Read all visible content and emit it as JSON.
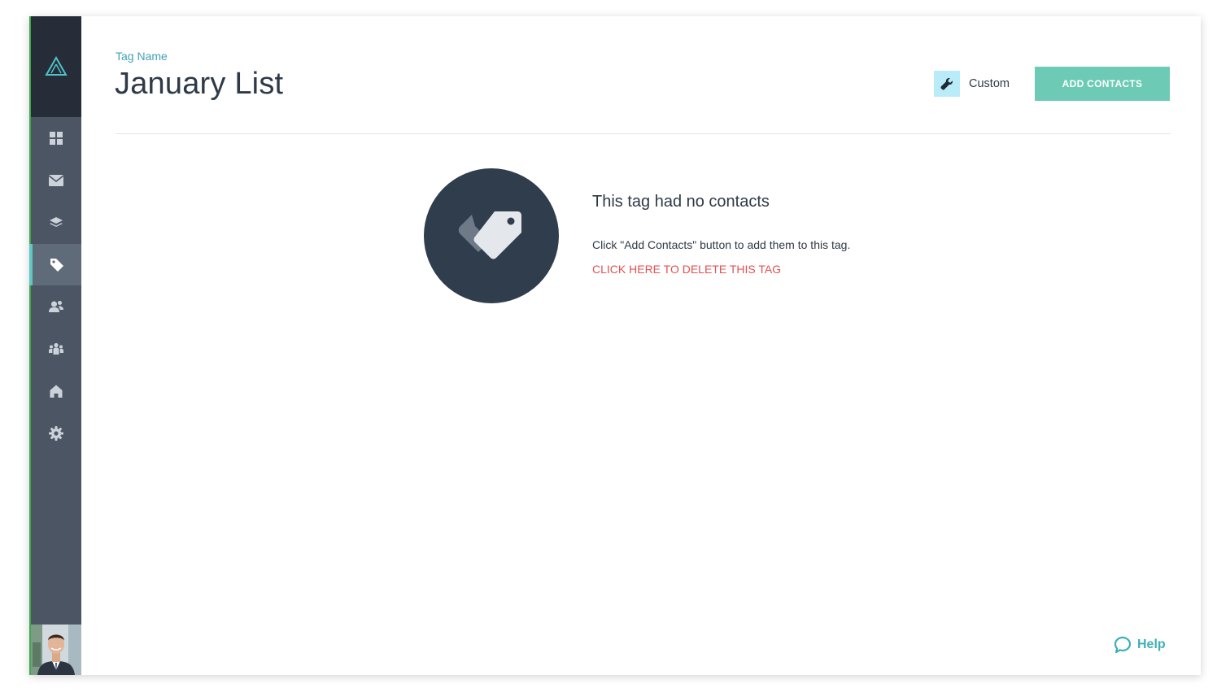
{
  "colors": {
    "sidebar_bg": "#4b5563",
    "sidebar_logo_bg": "#262d38",
    "sidebar_active_bg": "#5f6b79",
    "active_indicator": "#5fc7c4",
    "accent_teal": "#6ccab5",
    "eyebrow_blue": "#3fa1b8",
    "delete_red": "#e05253",
    "icon_circle": "#2f3d4d"
  },
  "sidebar": {
    "logo_icon": "triangle-logo-icon",
    "items": [
      {
        "name": "dashboard",
        "icon": "grid-icon",
        "active": false
      },
      {
        "name": "mail",
        "icon": "envelope-icon",
        "active": false
      },
      {
        "name": "layers",
        "icon": "layers-icon",
        "active": false
      },
      {
        "name": "tags",
        "icon": "tag-icon",
        "active": true
      },
      {
        "name": "contacts",
        "icon": "users-icon",
        "active": false
      },
      {
        "name": "groups",
        "icon": "group-icon",
        "active": false
      },
      {
        "name": "home",
        "icon": "home-icon",
        "active": false
      },
      {
        "name": "settings",
        "icon": "gear-icon",
        "active": false
      }
    ],
    "avatar": "user-avatar"
  },
  "header": {
    "eyebrow": "Tag Name",
    "title": "January List",
    "custom_label": "Custom",
    "add_button_label": "ADD CONTACTS"
  },
  "empty_state": {
    "icon": "tags-icon",
    "title": "This tag had no contacts",
    "description": "Click \"Add Contacts\" button to add them to this tag.",
    "delete_link": "CLICK HERE TO DELETE THIS TAG"
  },
  "help": {
    "label": "Help",
    "icon": "chat-bubble-icon"
  }
}
